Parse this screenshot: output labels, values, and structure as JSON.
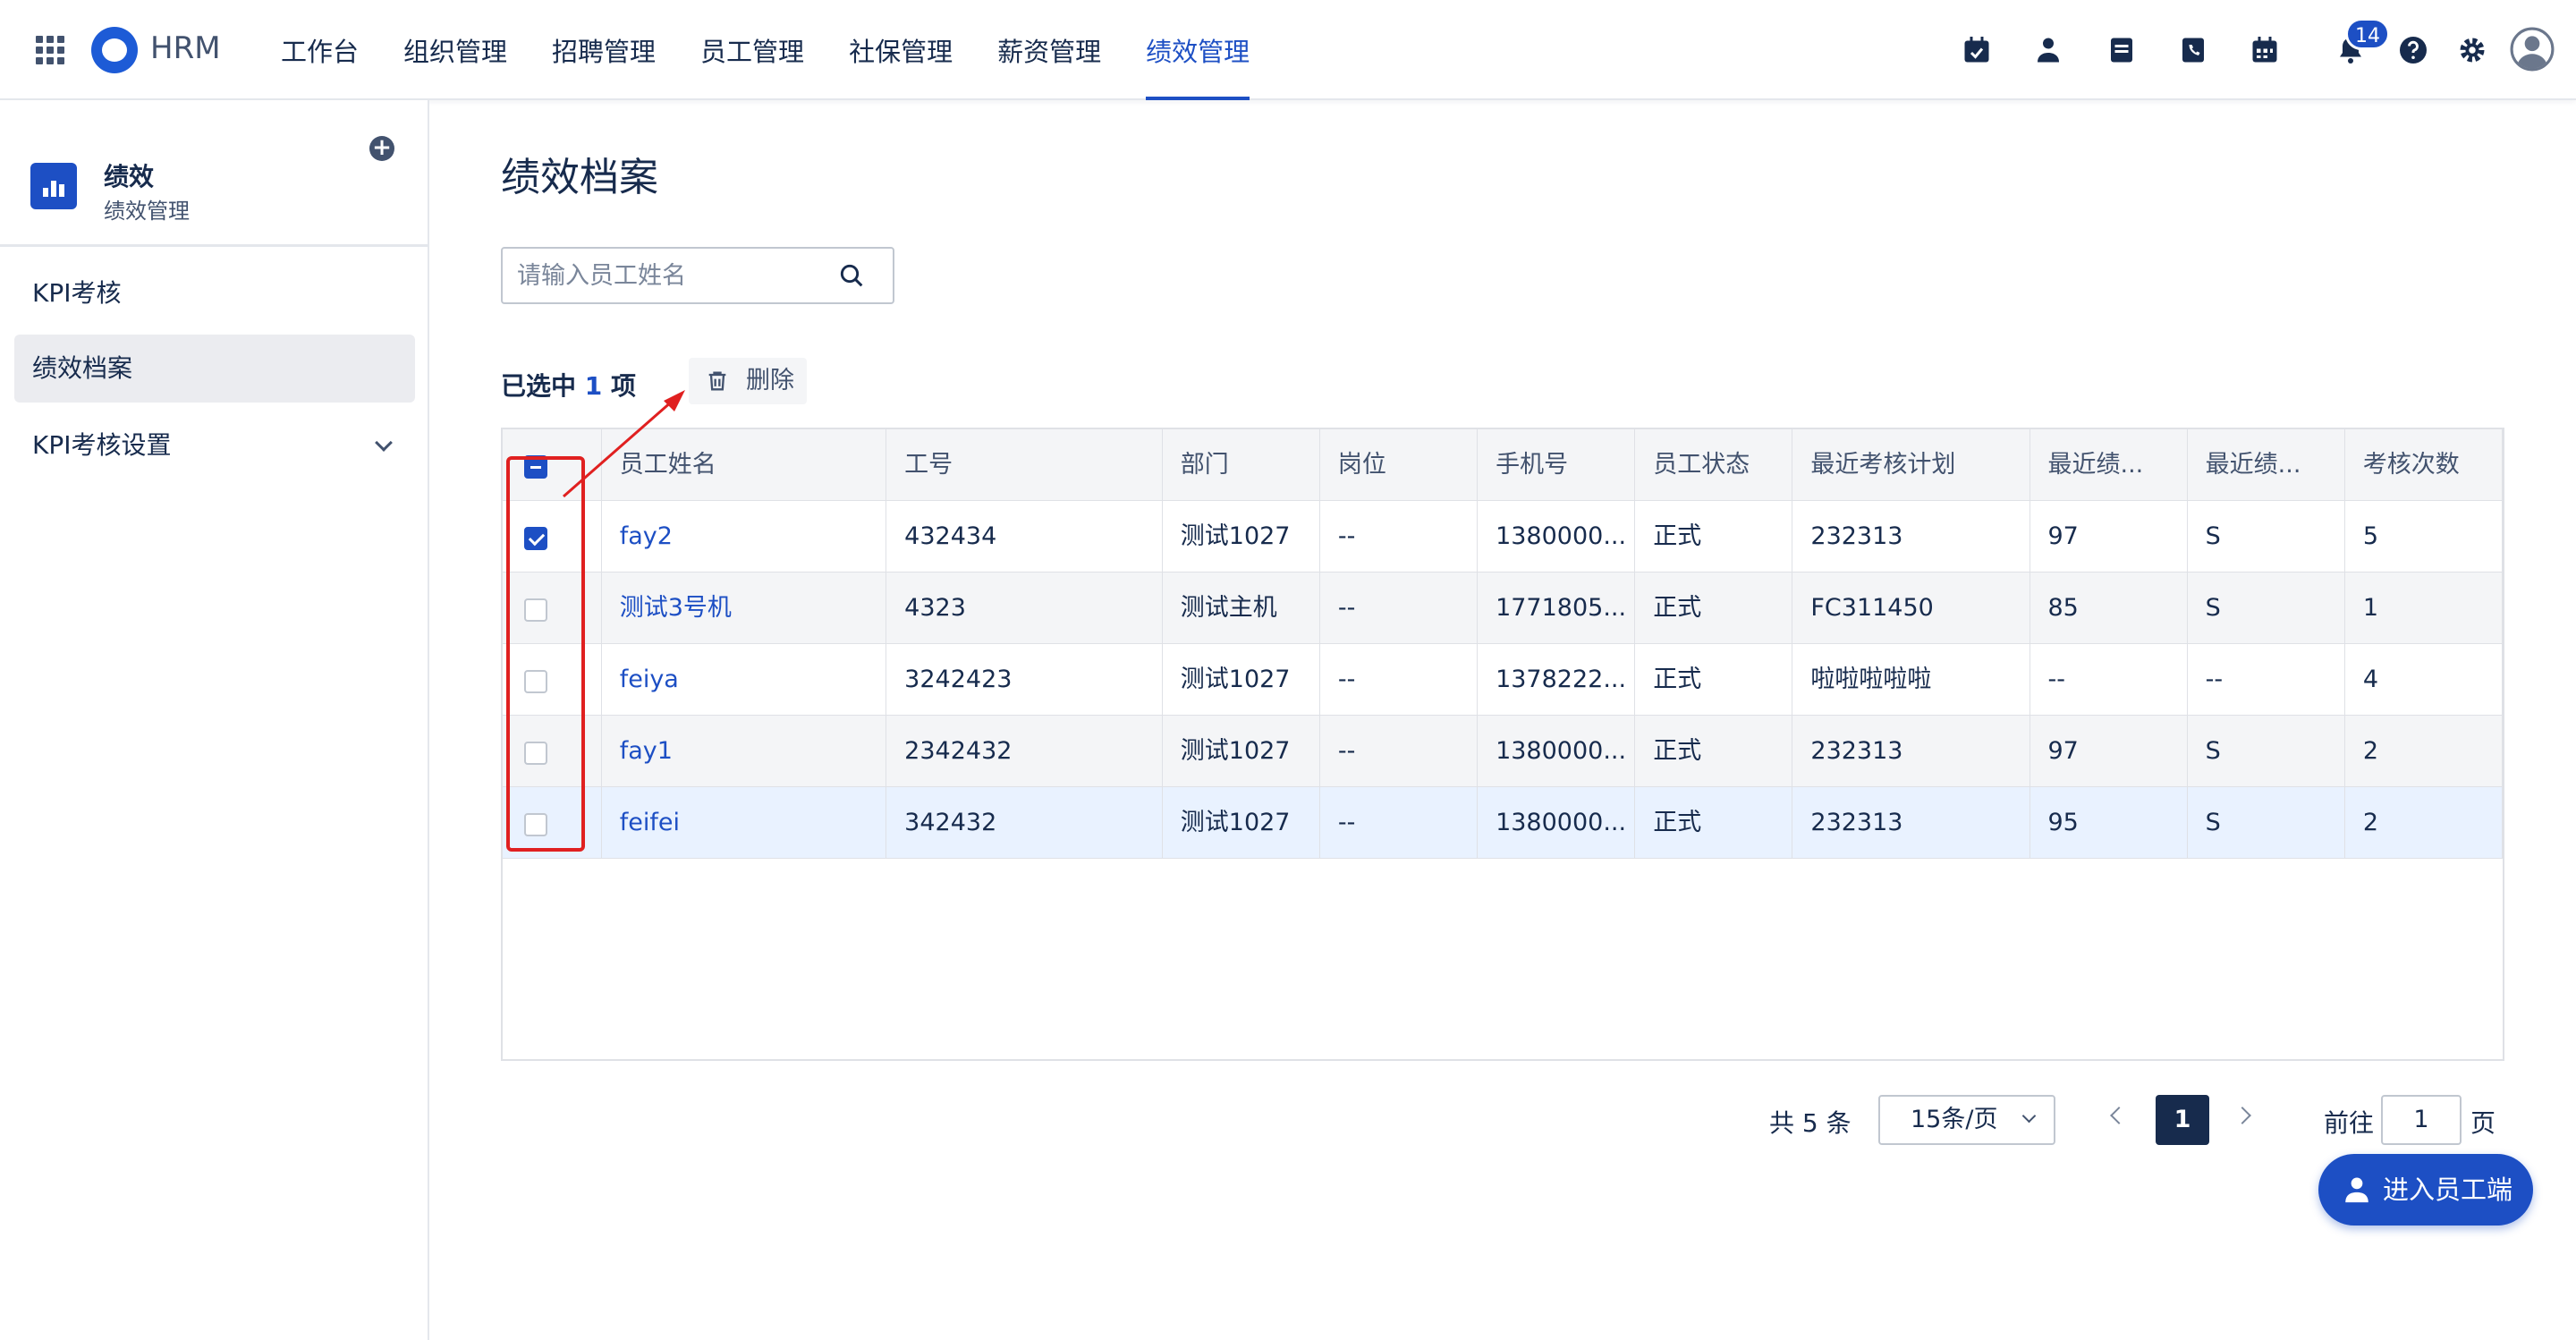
{
  "app": {
    "brand": "HRM"
  },
  "nav": [
    "工作台",
    "组织管理",
    "招聘管理",
    "员工管理",
    "社保管理",
    "薪资管理",
    "绩效管理"
  ],
  "nav_active_index": 6,
  "notifications": {
    "count": "14"
  },
  "colors": {
    "accent": "#1d4fc4",
    "text": "#172b4d",
    "annotation": "#e02020"
  },
  "sidebar": {
    "title": "绩效",
    "subtitle": "绩效管理",
    "items": [
      {
        "label": "KPI考核"
      },
      {
        "label": "绩效档案"
      },
      {
        "label": "KPI考核设置"
      }
    ]
  },
  "main": {
    "title": "绩效档案",
    "search_placeholder": "请输入员工姓名",
    "selection": {
      "prefix": "已选中",
      "count": "1",
      "suffix": "项"
    },
    "delete_label": "删除"
  },
  "table": {
    "headers": [
      "员工姓名",
      "工号",
      "部门",
      "岗位",
      "手机号",
      "员工状态",
      "最近考核计划",
      "最近绩...",
      "最近绩...",
      "考核次数"
    ],
    "rows": [
      {
        "checked": true,
        "cells": [
          "fay2",
          "432434",
          "测试1027",
          "--",
          "1380000...",
          "正式",
          "232313",
          "97",
          "S",
          "5"
        ]
      },
      {
        "checked": false,
        "cells": [
          "测试3号机",
          "4323",
          "测试主机",
          "--",
          "1771805...",
          "正式",
          "FC311450",
          "85",
          "S",
          "1"
        ]
      },
      {
        "checked": false,
        "cells": [
          "feiya",
          "3242423",
          "测试1027",
          "--",
          "1378222...",
          "正式",
          "啦啦啦啦啦",
          "--",
          "--",
          "4"
        ]
      },
      {
        "checked": false,
        "cells": [
          "fay1",
          "2342432",
          "测试1027",
          "--",
          "1380000...",
          "正式",
          "232313",
          "97",
          "S",
          "2"
        ]
      },
      {
        "checked": false,
        "cells": [
          "feifei",
          "342432",
          "测试1027",
          "--",
          "1380000...",
          "正式",
          "232313",
          "95",
          "S",
          "2"
        ]
      }
    ]
  },
  "pagination": {
    "total_label": "共 5 条",
    "page_size": "15条/页",
    "current_page": "1",
    "goto_prefix": "前往",
    "goto_value": "1",
    "goto_suffix": "页"
  },
  "fab_label": "进入员工端"
}
